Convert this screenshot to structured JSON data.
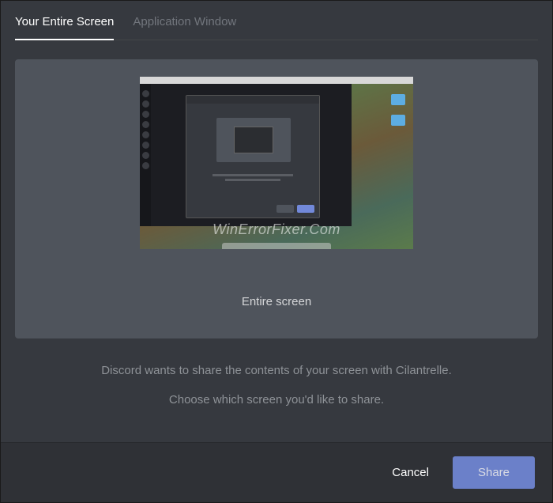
{
  "tabs": {
    "entire_screen": "Your Entire Screen",
    "application_window": "Application Window"
  },
  "screen_card": {
    "label": "Entire screen",
    "watermark": "WinErrorFixer.Com"
  },
  "info": {
    "line1": "Discord wants to share the contents of your screen with Cilantrelle.",
    "line2": "Choose which screen you'd like to share."
  },
  "footer": {
    "cancel": "Cancel",
    "share": "Share"
  }
}
